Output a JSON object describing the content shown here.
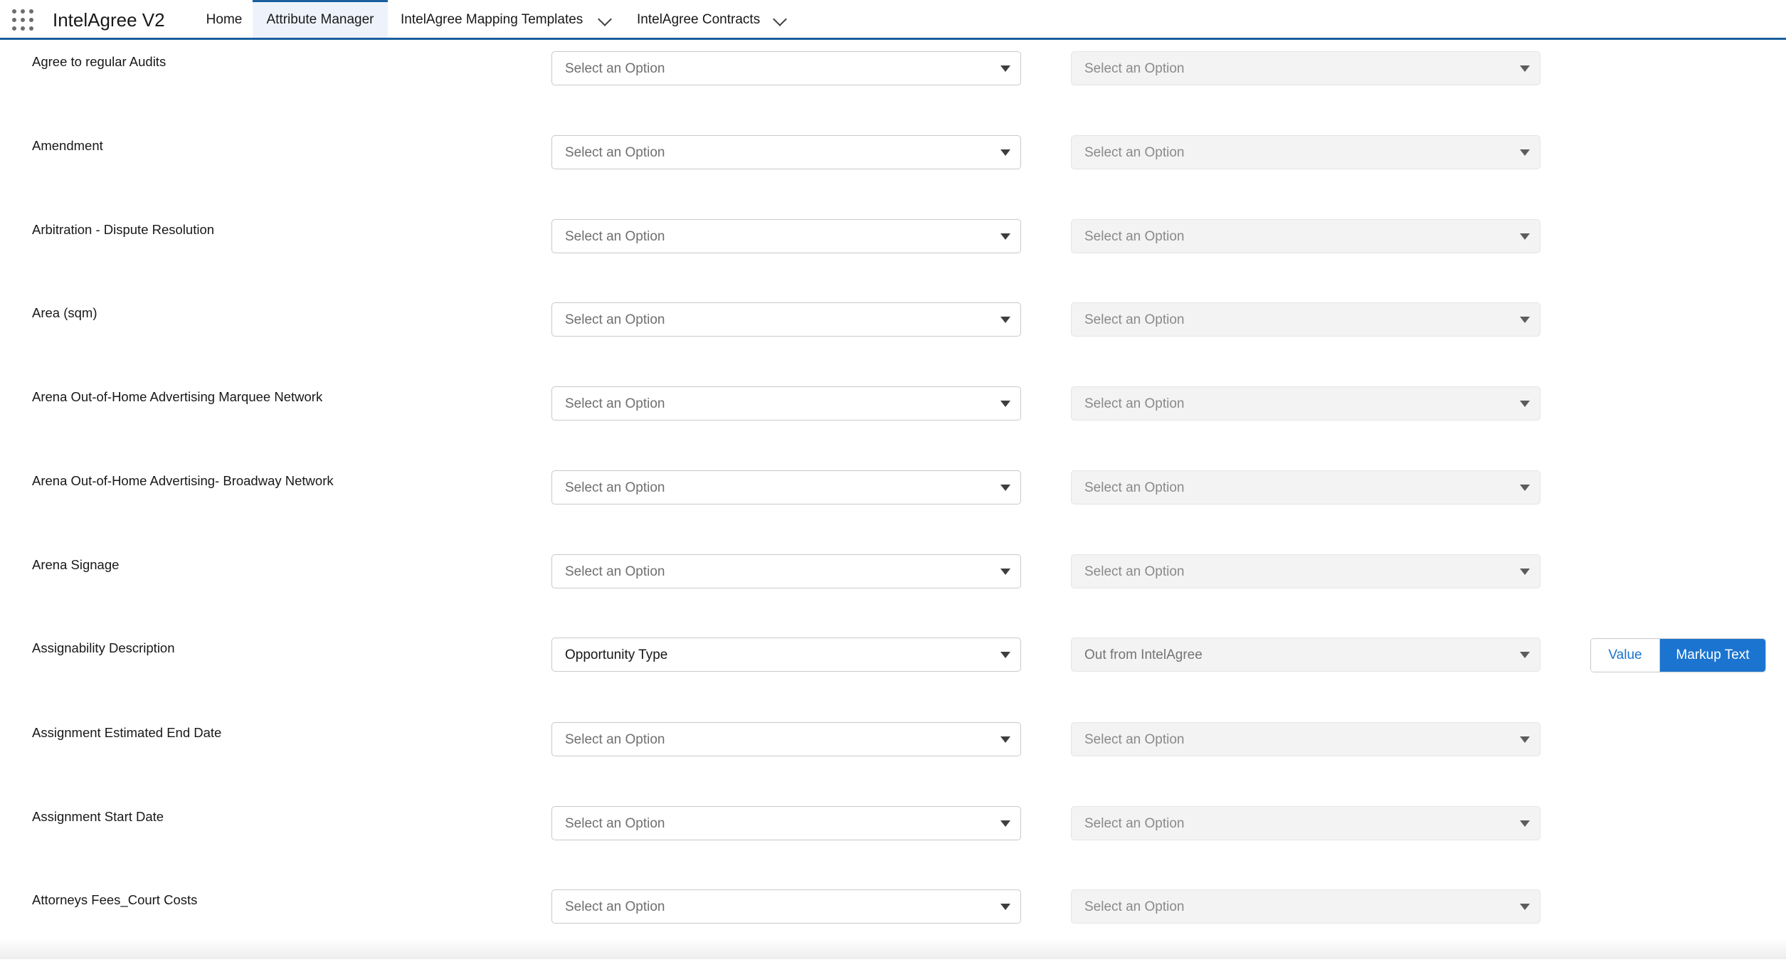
{
  "app": {
    "name": "IntelAgree V2"
  },
  "nav": {
    "home": "Home",
    "attribute_manager": "Attribute Manager",
    "mapping_templates": "IntelAgree Mapping Templates",
    "contracts": "IntelAgree Contracts"
  },
  "rows": [
    {
      "label": "Agree to regular Audits",
      "left": "Select an Option",
      "right": "Select an Option"
    },
    {
      "label": "Amendment",
      "left": "Select an Option",
      "right": "Select an Option"
    },
    {
      "label": "Arbitration - Dispute Resolution",
      "left": "Select an Option",
      "right": "Select an Option"
    },
    {
      "label": "Area (sqm)",
      "left": "Select an Option",
      "right": "Select an Option"
    },
    {
      "label": "Arena Out-of-Home Advertising Marquee Network",
      "left": "Select an Option",
      "right": "Select an Option"
    },
    {
      "label": "Arena Out-of-Home Advertising- Broadway Network",
      "left": "Select an Option",
      "right": "Select an Option"
    },
    {
      "label": "Arena Signage",
      "left": "Select an Option",
      "right": "Select an Option"
    },
    {
      "label": "Assignability Description",
      "left": "Opportunity Type",
      "right": "Out from IntelAgree",
      "toggle": {
        "value_label": "Value",
        "markup_label": "Markup Text",
        "selected": "Markup Text"
      }
    },
    {
      "label": "Assignment Estimated End Date",
      "left": "Select an Option",
      "right": "Select an Option"
    },
    {
      "label": "Assignment Start Date",
      "left": "Select an Option",
      "right": "Select an Option"
    },
    {
      "label": "Attorneys Fees_Court Costs",
      "left": "Select an Option",
      "right": "Select an Option"
    }
  ],
  "colors": {
    "accent": "#1b74d0",
    "nav_border": "#1b5f9e",
    "active_tab_bg": "#eef3fb"
  }
}
